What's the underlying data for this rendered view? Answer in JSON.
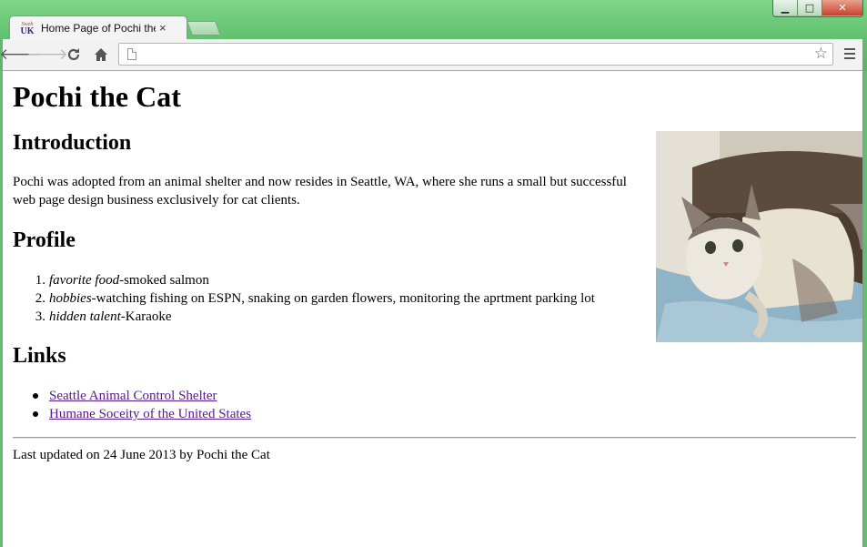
{
  "browser": {
    "tab_title": "Home Page of Pochi the C",
    "tab_close": "×",
    "favicon_text_small": "Sweb",
    "favicon_text_big": "UK",
    "address": "",
    "icons": {
      "back": "back-arrow-icon",
      "forward": "forward-arrow-icon",
      "reload": "reload-icon",
      "home": "home-icon",
      "bookmark": "star-icon",
      "menu": "menu-icon"
    }
  },
  "page": {
    "title": "Pochi the Cat",
    "intro": {
      "heading": "Introduction",
      "text": "Pochi was adopted from an animal shelter and now resides in Seattle, WA, where she runs a small but successful web page design business exclusively for cat clients."
    },
    "profile": {
      "heading": "Profile",
      "items": [
        {
          "num": "1.",
          "label": "favorite food",
          "value": "-smoked salmon"
        },
        {
          "num": "2.",
          "label": "hobbies",
          "value": "-watching fishing on ESPN, snaking on garden flowers, monitoring the aprtment parking lot"
        },
        {
          "num": "3.",
          "label": "hidden talent",
          "value": "-Karaoke"
        }
      ]
    },
    "links": {
      "heading": "Links",
      "items": [
        {
          "text": "Seattle Animal Control Shelter"
        },
        {
          "text": "Humane Soceity of the United States"
        }
      ]
    },
    "footer": "Last updated on 24 June 2013 by Pochi the Cat"
  },
  "colors": {
    "frame_green": "#5fc06f",
    "visited_link": "#551a8b"
  }
}
